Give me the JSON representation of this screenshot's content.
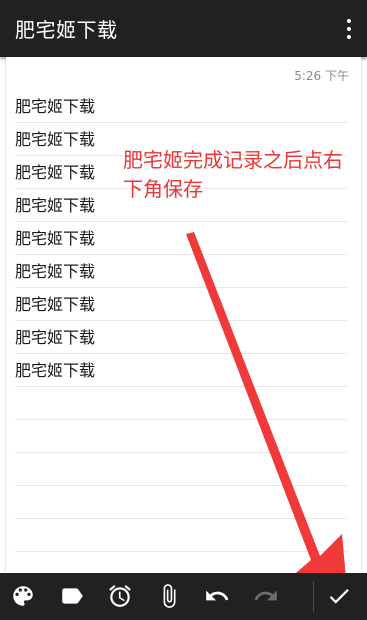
{
  "app": {
    "title": "肥宅姬下载"
  },
  "note": {
    "time": "5:26 下午",
    "lines": [
      "肥宅姬下载",
      "肥宅姬下载",
      "肥宅姬下载",
      "肥宅姬下载",
      "肥宅姬下载",
      "肥宅姬下载",
      "肥宅姬下载",
      "肥宅姬下载",
      "肥宅姬下载",
      "",
      "",
      "",
      "",
      "",
      ""
    ]
  },
  "annotation": {
    "text": "肥宅姬完成记录之后点右下角保存",
    "color": "#ee3535"
  },
  "toolbar": {
    "icons": [
      "palette-icon",
      "label-icon",
      "alarm-icon",
      "attachment-icon",
      "undo-icon",
      "redo-icon",
      "check-icon"
    ]
  },
  "colors": {
    "appbar": "#212121",
    "toolbar": "#212121",
    "accent": "#ee3535"
  }
}
